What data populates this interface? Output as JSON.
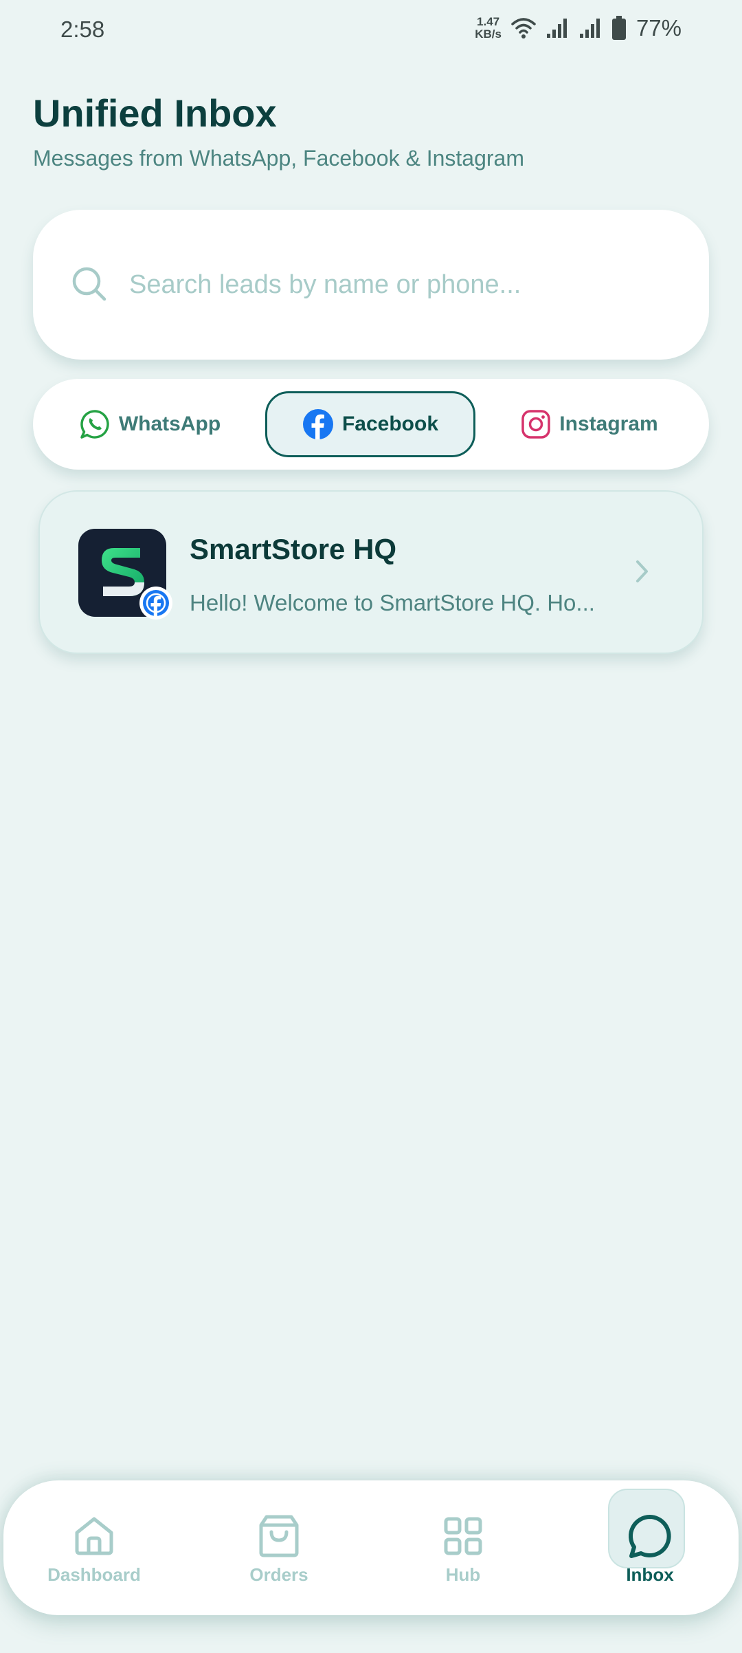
{
  "status_bar": {
    "time": "2:58",
    "net_speed_value": "1.47",
    "net_speed_unit": "KB/s",
    "battery": "77%"
  },
  "header": {
    "title": "Unified Inbox",
    "subtitle": "Messages from WhatsApp, Facebook & Instagram"
  },
  "search": {
    "placeholder": "Search leads by name or phone...",
    "value": ""
  },
  "tabs": [
    {
      "label": "WhatsApp",
      "icon": "whatsapp-icon",
      "selected": false
    },
    {
      "label": "Facebook",
      "icon": "facebook-icon",
      "selected": true
    },
    {
      "label": "Instagram",
      "icon": "instagram-icon",
      "selected": false
    }
  ],
  "conversations": [
    {
      "name": "SmartStore HQ",
      "preview": "Hello! Welcome to SmartStore HQ. Ho...",
      "channel": "facebook",
      "avatar": "smartstore-logo"
    }
  ],
  "bottom_nav": [
    {
      "label": "Dashboard",
      "icon": "home-icon",
      "active": false
    },
    {
      "label": "Orders",
      "icon": "shopping-bag-icon",
      "active": false
    },
    {
      "label": "Hub",
      "icon": "grid-icon",
      "active": false
    },
    {
      "label": "Inbox",
      "icon": "chat-bubble-icon",
      "active": true
    }
  ],
  "colors": {
    "background": "#ebf4f3",
    "primary": "#0e5e59",
    "title": "#0c3f3e",
    "muted": "#a8cdca",
    "facebook": "#1877f2",
    "whatsapp": "#25a244",
    "instagram": "#d6336c"
  }
}
